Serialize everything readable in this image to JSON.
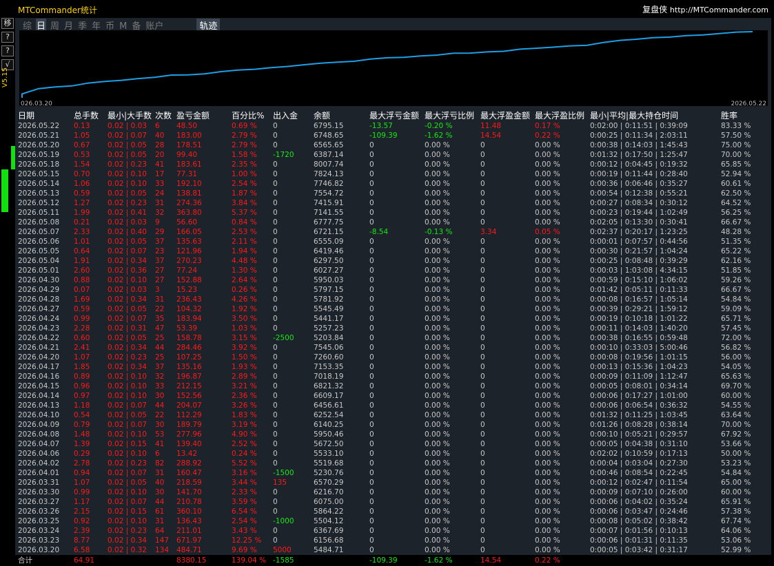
{
  "app": {
    "title": "MTCommander统计",
    "brand_name": "复盘侠",
    "brand_url": "http://MTCommander.com",
    "version": "V5.15"
  },
  "left_toolbar": [
    "移",
    "?",
    "?",
    "√"
  ],
  "tabs": [
    "综",
    "日",
    "周",
    "月",
    "季",
    "年",
    "币",
    "M",
    "备",
    "账户",
    "轨迹"
  ],
  "active_tab": "日",
  "colors": {
    "accent": "#ffd400",
    "profit": "#ff1a1a",
    "loss": "#18e818",
    "line": "#1ea0e6"
  },
  "chart": {
    "x_start_label": "026.03.20",
    "x_end_label": "2026.05.22"
  },
  "chart_data": {
    "type": "line",
    "x": [
      "2026.03.20",
      "2026.03.23",
      "2026.03.24",
      "2026.03.25",
      "2026.03.26",
      "2026.03.27",
      "2026.03.30",
      "2026.03.31",
      "2026.04.01",
      "2026.04.02",
      "2026.04.06",
      "2026.04.07",
      "2026.04.08",
      "2026.04.09",
      "2026.04.10",
      "2026.04.13",
      "2026.04.14",
      "2026.04.15",
      "2026.04.16",
      "2026.04.17",
      "2026.04.20",
      "2026.04.21",
      "2026.04.22",
      "2026.04.23",
      "2026.04.24",
      "2026.04.27",
      "2026.04.28",
      "2026.04.29",
      "2026.04.30",
      "2026.05.01",
      "2026.05.04",
      "2026.05.05",
      "2026.05.06",
      "2026.05.07",
      "2026.05.08",
      "2026.05.11",
      "2026.05.12",
      "2026.05.13",
      "2026.05.14",
      "2026.05.15",
      "2026.05.18",
      "2026.05.19",
      "2026.05.20",
      "2026.05.21",
      "2026.05.22"
    ],
    "series": [
      {
        "values": [
          484.71,
          1156.68,
          1367.69,
          1504.12,
          1864.22,
          2075.0,
          2216.7,
          2435.29,
          2595.76,
          2884.68,
          2898.1,
          3037.5,
          3315.46,
          3505.25,
          3617.54,
          3821.61,
          3974.17,
          4186.32,
          4383.19,
          4518.35,
          4625.6,
          4910.06,
          5068.84,
          5122.23,
          5306.17,
          5410.49,
          5646.92,
          5662.15,
          5814.03,
          5891.27,
          6161.51,
          6283.47,
          6418.1,
          6584.15,
          6640.75,
          7004.55,
          7278.91,
          7417.72,
          7609.82,
          7687.13,
          7870.74,
          7970.14,
          8148.65,
          8331.65,
          8380.15
        ]
      }
    ]
  },
  "table": {
    "headers": [
      "日期",
      "总手数",
      "最小|大手数",
      "次数",
      "盈亏金额",
      "百分比%",
      "出入金",
      "余额",
      "最大浮亏金额",
      "最大浮亏比例",
      "最大浮盈金额",
      "最大浮盈比例",
      "最小|平均|最大持仓时间",
      "胜率"
    ],
    "rows": [
      [
        "2026.05.22",
        "0.13",
        "0.02 | 0.03",
        "6",
        "48.50",
        "0.69 %",
        "0",
        "6795.15",
        "-13.57",
        "-0.20 %",
        "11.48",
        "0.17 %",
        "0:02:00 | 0:11:51 | 0:39:09",
        "83.33 %"
      ],
      [
        "2026.05.21",
        "1.05",
        "0.02 | 0.07",
        "40",
        "183.00",
        "2.79 %",
        "0",
        "6748.65",
        "-109.39",
        "-1.62 %",
        "14.54",
        "0.22 %",
        "0:00:25 | 0:11:34 | 2:03:11",
        "57.50 %"
      ],
      [
        "2026.05.20",
        "0.67",
        "0.02 | 0.05",
        "28",
        "178.51",
        "2.79 %",
        "0",
        "6565.65",
        "0",
        "0.00 %",
        "0",
        "0.00 %",
        "0:00:38 | 0:14:03 | 1:45:43",
        "75.00 %"
      ],
      [
        "2026.05.19",
        "0.53",
        "0.02 | 0.05",
        "20",
        "99.40",
        "1.58 %",
        "-1720",
        "6387.14",
        "0",
        "0.00 %",
        "0",
        "0.00 %",
        "0:01:32 | 0:17:50 | 1:25:47",
        "70.00 %"
      ],
      [
        "2026.05.18",
        "1.54",
        "0.02 | 0.23",
        "41",
        "183.61",
        "2.35 %",
        "0",
        "8007.74",
        "0",
        "0.00 %",
        "0",
        "0.00 %",
        "0:00:12 | 0:04:45 | 0:19:32",
        "65.85 %"
      ],
      [
        "2026.05.15",
        "0.70",
        "0.02 | 0.10",
        "17",
        "77.31",
        "1.00 %",
        "0",
        "7824.13",
        "0",
        "0.00 %",
        "0",
        "0.00 %",
        "0:00:19 | 0:11:44 | 0:28:40",
        "52.94 %"
      ],
      [
        "2026.05.14",
        "1.06",
        "0.02 | 0.10",
        "33",
        "192.10",
        "2.54 %",
        "0",
        "7746.82",
        "0",
        "0.00 %",
        "0",
        "0.00 %",
        "0:00:36 | 0:06:46 | 0:35:27",
        "60.61 %"
      ],
      [
        "2026.05.13",
        "0.59",
        "0.02 | 0.05",
        "24",
        "138.81",
        "1.87 %",
        "0",
        "7554.72",
        "0",
        "0.00 %",
        "0",
        "0.00 %",
        "0:00:54 | 0:12:38 | 0:55:21",
        "62.50 %"
      ],
      [
        "2026.05.12",
        "1.27",
        "0.02 | 0.23",
        "31",
        "274.36",
        "3.84 %",
        "0",
        "7415.91",
        "0",
        "0.00 %",
        "0",
        "0.00 %",
        "0:00:27 | 0:08:34 | 0:30:12",
        "64.52 %"
      ],
      [
        "2026.05.11",
        "1.99",
        "0.02 | 0.41",
        "32",
        "363.80",
        "5.37 %",
        "0",
        "7141.55",
        "0",
        "0.00 %",
        "0",
        "0.00 %",
        "0:00:23 | 0:19:44 | 1:02:49",
        "56.25 %"
      ],
      [
        "2026.05.08",
        "0.21",
        "0.02 | 0.03",
        "9",
        "56.60",
        "0.84 %",
        "0",
        "6777.75",
        "0",
        "0.00 %",
        "0",
        "0.00 %",
        "0:02:05 | 0:13:30 | 0:30:41",
        "66.67 %"
      ],
      [
        "2026.05.07",
        "2.33",
        "0.02 | 0.40",
        "29",
        "166.05",
        "2.53 %",
        "0",
        "6721.15",
        "-8.54",
        "-0.13 %",
        "3.34",
        "0.05 %",
        "0:02:37 | 0:20:17 | 1:23:25",
        "48.28 %"
      ],
      [
        "2026.05.06",
        "1.01",
        "0.02 | 0.05",
        "37",
        "135.63",
        "2.11 %",
        "0",
        "6555.09",
        "0",
        "0.00 %",
        "0",
        "0.00 %",
        "0:00:01 | 0:07:57 | 0:44:56",
        "51.35 %"
      ],
      [
        "2026.05.05",
        "0.64",
        "0.02 | 0.07",
        "23",
        "121.96",
        "1.94 %",
        "0",
        "6419.46",
        "0",
        "0.00 %",
        "0",
        "0.00 %",
        "0:00:30 | 0:21:57 | 1:04:24",
        "65.22 %"
      ],
      [
        "2026.05.04",
        "1.91",
        "0.02 | 0.34",
        "37",
        "270.23",
        "4.48 %",
        "0",
        "6297.50",
        "0",
        "0.00 %",
        "0",
        "0.00 %",
        "0:00:25 | 0:08:48 | 0:39:29",
        "62.16 %"
      ],
      [
        "2026.05.01",
        "2.60",
        "0.02 | 0.36",
        "27",
        "77.24",
        "1.30 %",
        "0",
        "6027.27",
        "0",
        "0.00 %",
        "0",
        "0.00 %",
        "0:00:03 | 1:03:08 | 4:34:15",
        "51.85 %"
      ],
      [
        "2026.04.30",
        "0.88",
        "0.02 | 0.10",
        "27",
        "152.88",
        "2.64 %",
        "0",
        "5950.03",
        "0",
        "0.00 %",
        "0",
        "0.00 %",
        "0:00:59 | 0:15:10 | 1:06:02",
        "59.26 %"
      ],
      [
        "2026.04.29",
        "0.07",
        "0.02 | 0.03",
        "3",
        "15.23",
        "0.26 %",
        "0",
        "5797.15",
        "0",
        "0.00 %",
        "0",
        "0.00 %",
        "0:01:42 | 0:05:11 | 0:11:33",
        "66.67 %"
      ],
      [
        "2026.04.28",
        "1.69",
        "0.02 | 0.34",
        "31",
        "236.43",
        "4.26 %",
        "0",
        "5781.92",
        "0",
        "0.00 %",
        "0",
        "0.00 %",
        "0:00:08 | 0:16:57 | 1:05:14",
        "54.84 %"
      ],
      [
        "2026.04.27",
        "0.59",
        "0.02 | 0.05",
        "22",
        "104.32",
        "1.92 %",
        "0",
        "5545.49",
        "0",
        "0.00 %",
        "0",
        "0.00 %",
        "0:00:39 | 0:29:21 | 1:59:12",
        "59.09 %"
      ],
      [
        "2026.04.24",
        "0.99",
        "0.02 | 0.07",
        "35",
        "183.94",
        "3.50 %",
        "0",
        "5441.17",
        "0",
        "0.00 %",
        "0",
        "0.00 %",
        "0:00:19 | 0:10:18 | 1:01:22",
        "65.71 %"
      ],
      [
        "2026.04.23",
        "2.28",
        "0.02 | 0.31",
        "47",
        "53.39",
        "1.03 %",
        "0",
        "5257.23",
        "0",
        "0.00 %",
        "0",
        "0.00 %",
        "0:00:11 | 0:14:03 | 1:40:20",
        "57.45 %"
      ],
      [
        "2026.04.22",
        "0.60",
        "0.02 | 0.05",
        "25",
        "158.78",
        "3.15 %",
        "-2500",
        "5203.84",
        "0",
        "0.00 %",
        "0",
        "0.00 %",
        "0:00:38 | 0:16:55 | 0:59:48",
        "72.00 %"
      ],
      [
        "2026.04.21",
        "2.41",
        "0.02 | 0.34",
        "44",
        "284.46",
        "3.92 %",
        "0",
        "7545.06",
        "0",
        "0.00 %",
        "0",
        "0.00 %",
        "0:00:10 | 0:33:03 | 5:00:46",
        "56.82 %"
      ],
      [
        "2026.04.20",
        "1.07",
        "0.02 | 0.23",
        "25",
        "107.25",
        "1.50 %",
        "0",
        "7260.60",
        "0",
        "0.00 %",
        "0",
        "0.00 %",
        "0:00:08 | 0:19:56 | 1:01:15",
        "56.00 %"
      ],
      [
        "2026.04.17",
        "1.85",
        "0.02 | 0.34",
        "37",
        "135.16",
        "1.93 %",
        "0",
        "7153.35",
        "0",
        "0.00 %",
        "0",
        "0.00 %",
        "0:00:13 | 0:15:36 | 1:04:23",
        "54.05 %"
      ],
      [
        "2026.04.16",
        "0.89",
        "0.02 | 0.10",
        "32",
        "196.87",
        "2.89 %",
        "0",
        "7018.19",
        "0",
        "0.00 %",
        "0",
        "0.00 %",
        "0:00:09 | 0:11:09 | 1:12:47",
        "65.63 %"
      ],
      [
        "2026.04.15",
        "0.96",
        "0.02 | 0.10",
        "33",
        "212.15",
        "3.21 %",
        "0",
        "6821.32",
        "0",
        "0.00 %",
        "0",
        "0.00 %",
        "0:00:05 | 0:08:01 | 0:34:14",
        "69.70 %"
      ],
      [
        "2026.04.14",
        "0.97",
        "0.02 | 0.10",
        "30",
        "152.56",
        "2.36 %",
        "0",
        "6609.17",
        "0",
        "0.00 %",
        "0",
        "0.00 %",
        "0:00:06 | 0:17:27 | 1:01:00",
        "60.00 %"
      ],
      [
        "2026.04.13",
        "1.18",
        "0.02 | 0.07",
        "44",
        "204.07",
        "3.26 %",
        "0",
        "6456.61",
        "0",
        "0.00 %",
        "0",
        "0.00 %",
        "0:00:06 | 0:06:54 | 0:36:32",
        "54.55 %"
      ],
      [
        "2026.04.10",
        "0.54",
        "0.02 | 0.05",
        "22",
        "112.29",
        "1.83 %",
        "0",
        "6252.54",
        "0",
        "0.00 %",
        "0",
        "0.00 %",
        "0:01:32 | 0:11:25 | 1:03:45",
        "63.64 %"
      ],
      [
        "2026.04.09",
        "0.79",
        "0.02 | 0.07",
        "30",
        "189.79",
        "3.19 %",
        "0",
        "6140.25",
        "0",
        "0.00 %",
        "0",
        "0.00 %",
        "0:01:26 | 0:08:28 | 0:38:14",
        "70.00 %"
      ],
      [
        "2026.04.08",
        "1.48",
        "0.02 | 0.10",
        "53",
        "277.96",
        "4.90 %",
        "0",
        "5950.46",
        "0",
        "0.00 %",
        "0",
        "0.00 %",
        "0:00:10 | 0:05:21 | 0:29:57",
        "67.92 %"
      ],
      [
        "2026.04.07",
        "1.39",
        "0.02 | 0.15",
        "41",
        "139.40",
        "2.52 %",
        "0",
        "5672.50",
        "0",
        "0.00 %",
        "0",
        "0.00 %",
        "0:00:05 | 0:04:38 | 0:31:10",
        "53.66 %"
      ],
      [
        "2026.04.06",
        "0.29",
        "0.02 | 0.10",
        "6",
        "13.42",
        "0.24 %",
        "0",
        "5533.10",
        "0",
        "0.00 %",
        "0",
        "0.00 %",
        "0:02:02 | 0:10:59 | 0:17:13",
        "50.00 %"
      ],
      [
        "2026.04.02",
        "2.78",
        "0.02 | 0.23",
        "82",
        "288.92",
        "5.52 %",
        "0",
        "5519.68",
        "0",
        "0.00 %",
        "0",
        "0.00 %",
        "0:00:04 | 0:03:04 | 0:27:30",
        "53.23 %"
      ],
      [
        "2026.04.01",
        "0.94",
        "0.02 | 0.07",
        "31",
        "160.47",
        "3.16 %",
        "-1500",
        "5230.76",
        "0",
        "0.00 %",
        "0",
        "0.00 %",
        "0:00:46 | 0:08:54 | 0:22:45",
        "54.84 %"
      ],
      [
        "2026.03.31",
        "1.07",
        "0.02 | 0.05",
        "40",
        "218.59",
        "3.44 %",
        "135",
        "6570.29",
        "0",
        "0.00 %",
        "0",
        "0.00 %",
        "0:00:12 | 0:02:47 | 0:11:54",
        "65.00 %"
      ],
      [
        "2026.03.30",
        "0.99",
        "0.02 | 0.10",
        "30",
        "141.70",
        "2.33 %",
        "0",
        "6216.70",
        "0",
        "0.00 %",
        "0",
        "0.00 %",
        "0:00:09 | 0:07:10 | 0:26:00",
        "60.00 %"
      ],
      [
        "2026.03.27",
        "1.17",
        "0.02 | 0.07",
        "44",
        "210.78",
        "3.59 %",
        "0",
        "6075.00",
        "0",
        "0.00 %",
        "0",
        "0.00 %",
        "0:00:06 | 0:04:02 | 0:35:24",
        "65.91 %"
      ],
      [
        "2026.03.26",
        "2.15",
        "0.02 | 0.15",
        "61",
        "360.10",
        "6.54 %",
        "0",
        "5864.22",
        "0",
        "0.00 %",
        "0",
        "0.00 %",
        "0:00:06 | 0:03:47 | 0:24:46",
        "57.38 %"
      ],
      [
        "2026.03.25",
        "0.92",
        "0.02 | 0.10",
        "31",
        "136.43",
        "2.54 %",
        "-1000",
        "5504.12",
        "0",
        "0.00 %",
        "0",
        "0.00 %",
        "0:00:08 | 0:05:02 | 0:38:42",
        "67.74 %"
      ],
      [
        "2026.03.24",
        "2.39",
        "0.02 | 0.23",
        "64",
        "211.01",
        "3.43 %",
        "0",
        "6367.69",
        "0",
        "0.00 %",
        "0",
        "0.00 %",
        "0:00:07 | 0:01:56 | 0:10:13",
        "64.06 %"
      ],
      [
        "2026.03.23",
        "8.77",
        "0.02 | 0.34",
        "147",
        "671.97",
        "12.25 %",
        "0",
        "6156.68",
        "0",
        "0.00 %",
        "0",
        "0.00 %",
        "0:00:06 | 0:01:31 | 0:11:35",
        "53.06 %"
      ],
      [
        "2026.03.20",
        "6.58",
        "0.02 | 0.32",
        "134",
        "484.71",
        "9.69 %",
        "5000",
        "5484.71",
        "0",
        "0.00 %",
        "0",
        "0.00 %",
        "0:00:05 | 0:03:42 | 0:31:17",
        "52.99 %"
      ]
    ],
    "footer": [
      "合计",
      "64.91",
      "",
      "",
      "8380.15",
      "139.04 %",
      "-1585",
      "",
      "-109.39",
      "-1.62 %",
      "14.54",
      "0.22 %",
      "",
      ""
    ]
  }
}
